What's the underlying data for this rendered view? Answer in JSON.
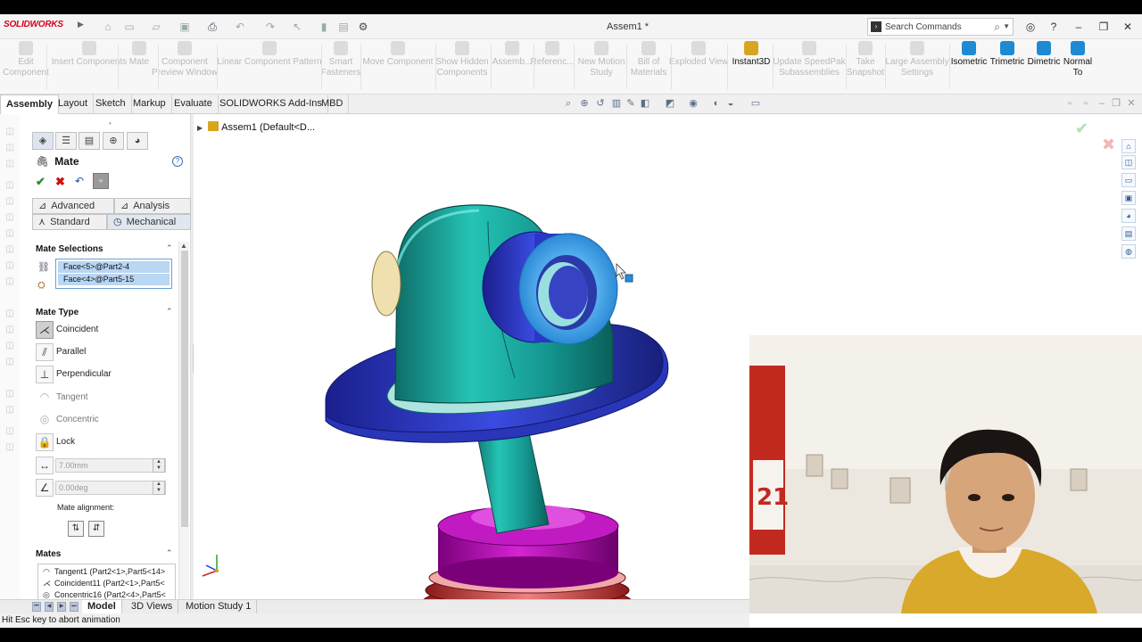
{
  "app": {
    "logo": "SOLIDWORKS",
    "document_title": "Assem1 *",
    "search_placeholder": "Search Commands"
  },
  "commands": [
    {
      "label": "Edit\nComponent",
      "enabled": false
    },
    {
      "label": "Insert Components",
      "enabled": false
    },
    {
      "label": "Mate",
      "enabled": false
    },
    {
      "label": "Component\nPreview Window",
      "enabled": false
    },
    {
      "label": "Linear Component Pattern",
      "enabled": false
    },
    {
      "label": "Smart\nFasteners",
      "enabled": false
    },
    {
      "label": "Move Component",
      "enabled": false
    },
    {
      "label": "Show Hidden\nComponents",
      "enabled": false
    },
    {
      "label": "Assemb...",
      "enabled": false
    },
    {
      "label": "Referenc...",
      "enabled": false
    },
    {
      "label": "New Motion\nStudy",
      "enabled": false
    },
    {
      "label": "Bill of\nMaterials",
      "enabled": false
    },
    {
      "label": "Exploded View",
      "enabled": false
    },
    {
      "label": "Instant3D",
      "enabled": true
    },
    {
      "label": "Update SpeedPak\nSubassemblies",
      "enabled": false
    },
    {
      "label": "Take\nSnapshot",
      "enabled": false
    },
    {
      "label": "Large Assembly\nSettings",
      "enabled": false
    },
    {
      "label": "Isometric",
      "enabled": true
    },
    {
      "label": "Trimetric",
      "enabled": true
    },
    {
      "label": "Dimetric",
      "enabled": true
    },
    {
      "label": "Normal\nTo",
      "enabled": true
    }
  ],
  "tabs": [
    "Assembly",
    "Layout",
    "Sketch",
    "Markup",
    "Evaluate",
    "SOLIDWORKS Add-Ins",
    "MBD"
  ],
  "pm": {
    "title": "Mate",
    "tabs": {
      "advanced": "Advanced",
      "analysis": "Analysis",
      "standard": "Standard",
      "mechanical": "Mechanical"
    },
    "mate_selections": {
      "header": "Mate Selections",
      "items": [
        "Face<5>@Part2-4",
        "Face<4>@Part5-15"
      ]
    },
    "mate_type": {
      "header": "Mate Type",
      "items": [
        "Coincident",
        "Parallel",
        "Perpendicular",
        "Tangent",
        "Concentric",
        "Lock"
      ]
    },
    "distance": "7.00mm",
    "angle": "0.00deg",
    "mate_alignment": "Mate alignment:",
    "mates": {
      "header": "Mates",
      "items": [
        "Tangent1 (Part2<1>,Part5<14>",
        "Coincident11 (Part2<1>,Part5<",
        "Concentric16 (Part2<4>,Part5<"
      ]
    }
  },
  "tree_root": "Assem1  (Default<D...",
  "bottom_tabs": [
    "Model",
    "3D Views",
    "Motion Study 1"
  ],
  "status": "Hit Esc key to abort animation",
  "colors": {
    "brand_red": "#d6001c",
    "selection_blue": "#b9d6f2",
    "part_teal": "#1aa8a0",
    "part_blue": "#2233aa",
    "part_magenta": "#b400b4"
  }
}
